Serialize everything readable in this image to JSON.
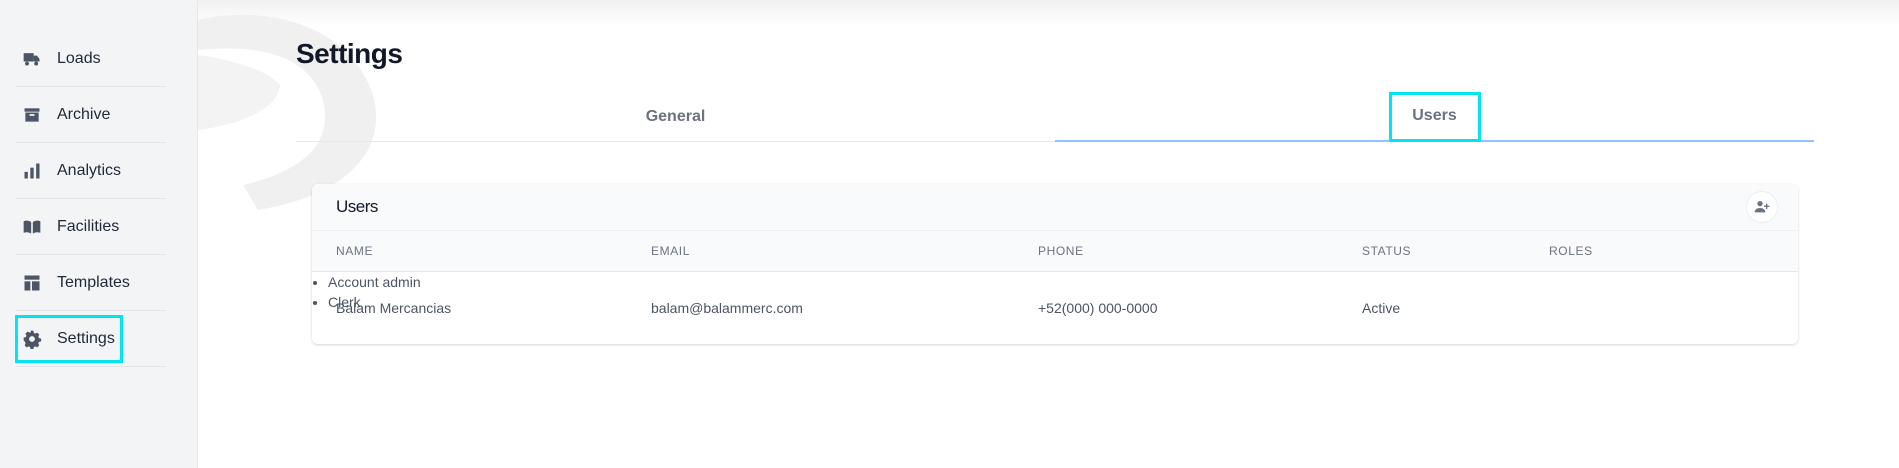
{
  "sidebar": {
    "items": [
      {
        "label": "Loads",
        "icon": "truck-icon"
      },
      {
        "label": "Archive",
        "icon": "archive-icon"
      },
      {
        "label": "Analytics",
        "icon": "bar-chart-icon"
      },
      {
        "label": "Facilities",
        "icon": "book-icon"
      },
      {
        "label": "Templates",
        "icon": "template-icon"
      },
      {
        "label": "Settings",
        "icon": "gear-icon",
        "active": true
      }
    ]
  },
  "page": {
    "title": "Settings"
  },
  "tabs": [
    {
      "label": "General",
      "active": false
    },
    {
      "label": "Users",
      "active": true
    }
  ],
  "users_card": {
    "title": "Users",
    "add_button_icon": "add-user-icon",
    "columns": [
      "NAME",
      "EMAIL",
      "PHONE",
      "STATUS",
      "ROLES"
    ],
    "rows": [
      {
        "name": "Balam Mercancias",
        "email": "balam@balammerc.com",
        "phone": "+52(000) 000-0000",
        "status": "Active",
        "roles": [
          "Account admin",
          "Clerk"
        ]
      }
    ]
  },
  "colors": {
    "highlight": "#00e5f0",
    "active_tab_underline": "#93c5fd",
    "sidebar_bg": "#f3f4f6"
  }
}
